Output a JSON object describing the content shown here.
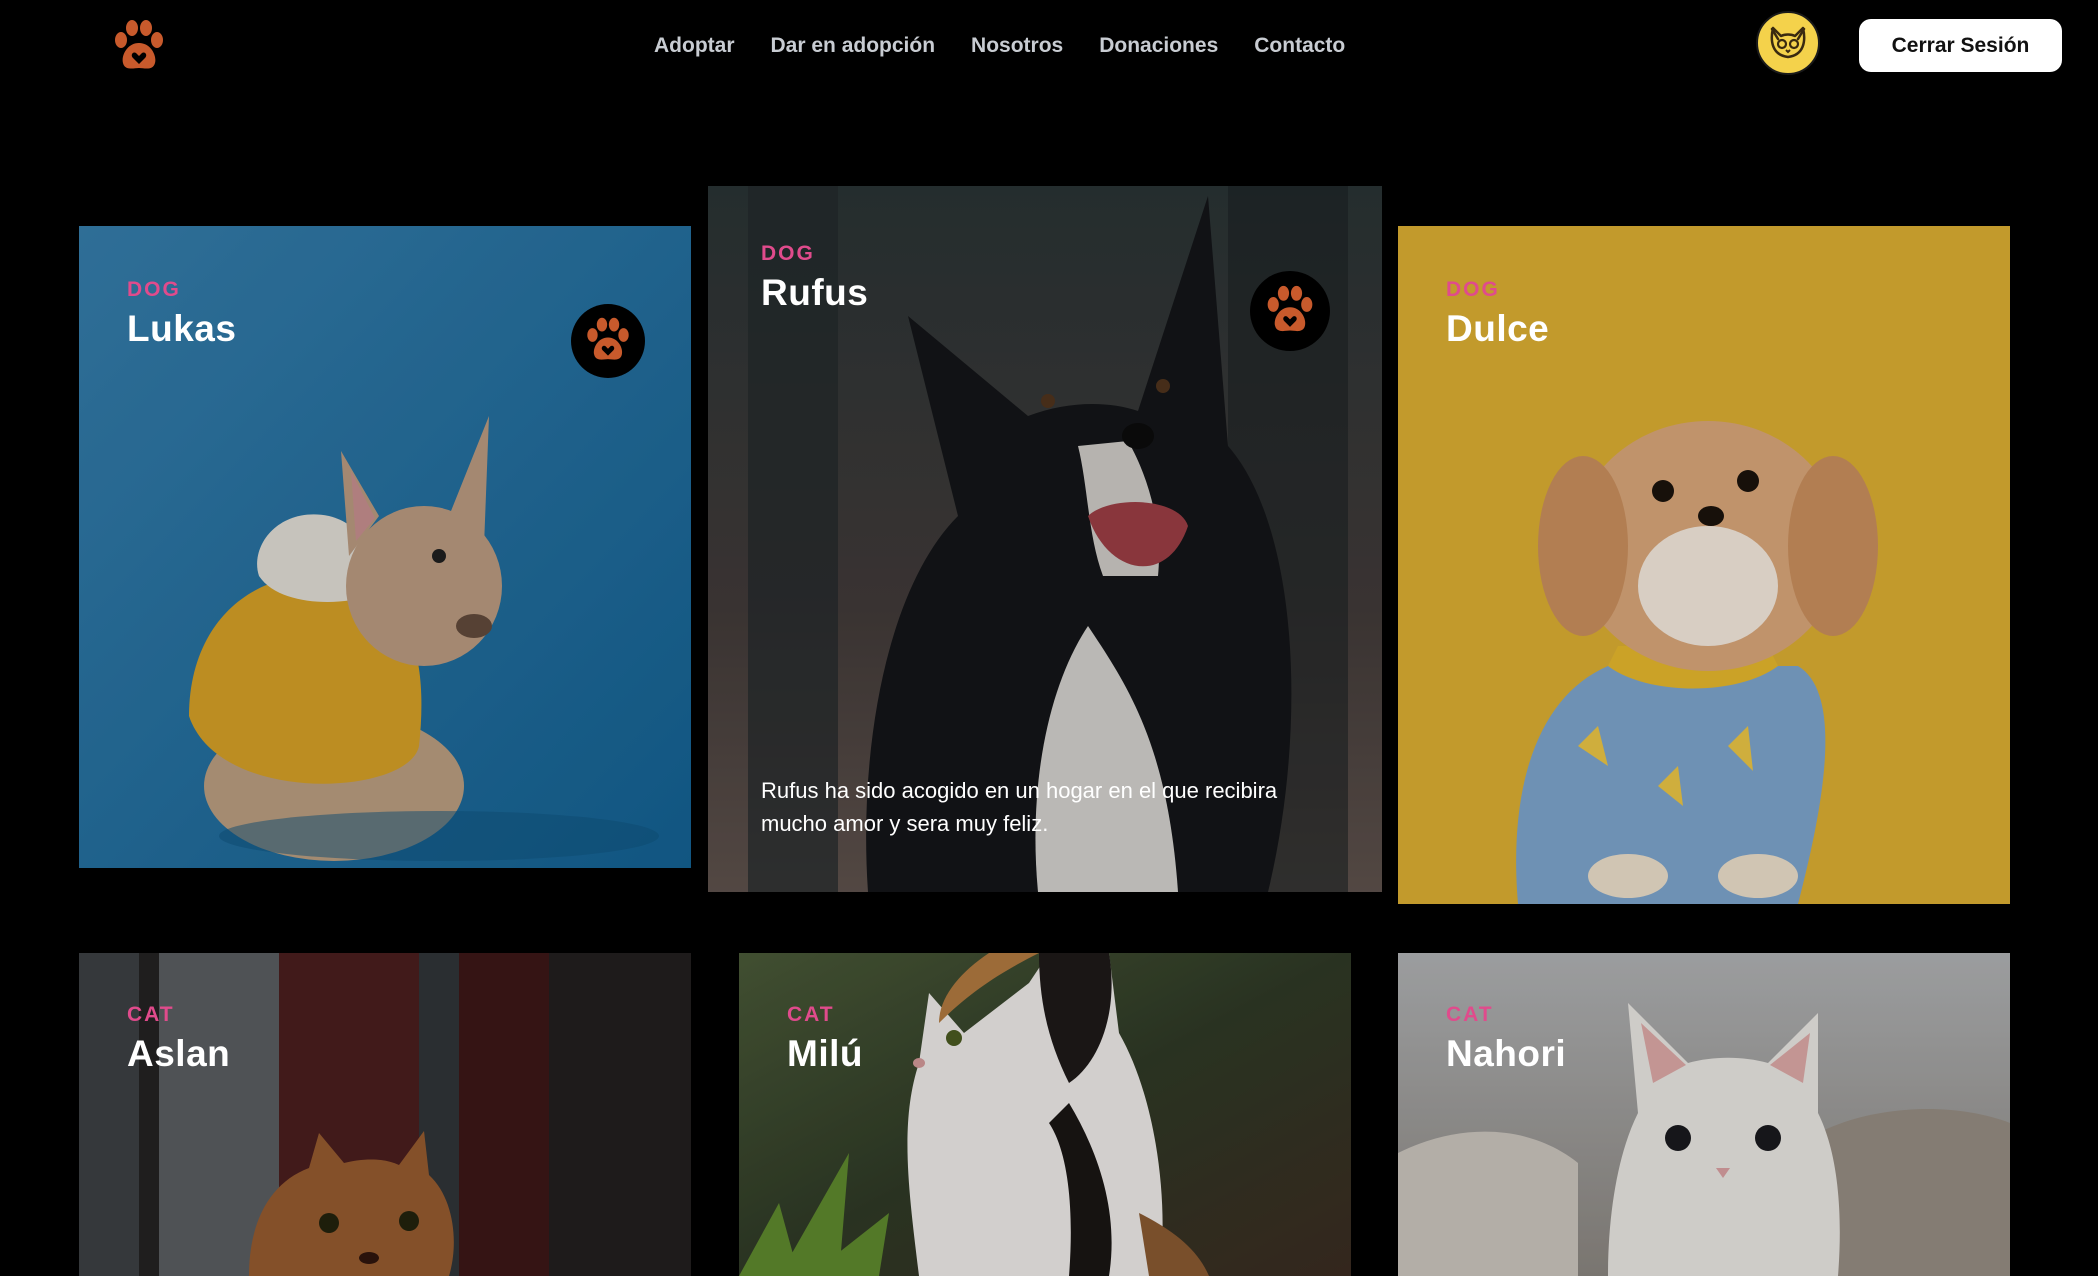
{
  "header": {
    "logo_icon": "paw-logo-icon",
    "nav": [
      {
        "label": "Adoptar"
      },
      {
        "label": "Dar en adopción"
      },
      {
        "label": "Nosotros"
      },
      {
        "label": "Donaciones"
      },
      {
        "label": "Contacto"
      }
    ],
    "avatar_icon": "cat-face-icon",
    "logout_label": "Cerrar Sesión"
  },
  "colors": {
    "background": "#000000",
    "accent_pink": "#e04b8c",
    "paw_orange": "#c85a2c",
    "avatar_yellow": "#f4d24b"
  },
  "pets": [
    {
      "type": "DOG",
      "name": "Lukas",
      "favorite_icon": "paw-heart-icon"
    },
    {
      "type": "DOG",
      "name": "Rufus",
      "favorite_icon": "paw-heart-icon",
      "description": "Rufus ha sido acogido en un hogar en el que recibira mucho amor y sera muy feliz."
    },
    {
      "type": "DOG",
      "name": "Dulce"
    },
    {
      "type": "CAT",
      "name": "Aslan"
    },
    {
      "type": "CAT",
      "name": "Milú"
    },
    {
      "type": "CAT",
      "name": "Nahori"
    }
  ]
}
